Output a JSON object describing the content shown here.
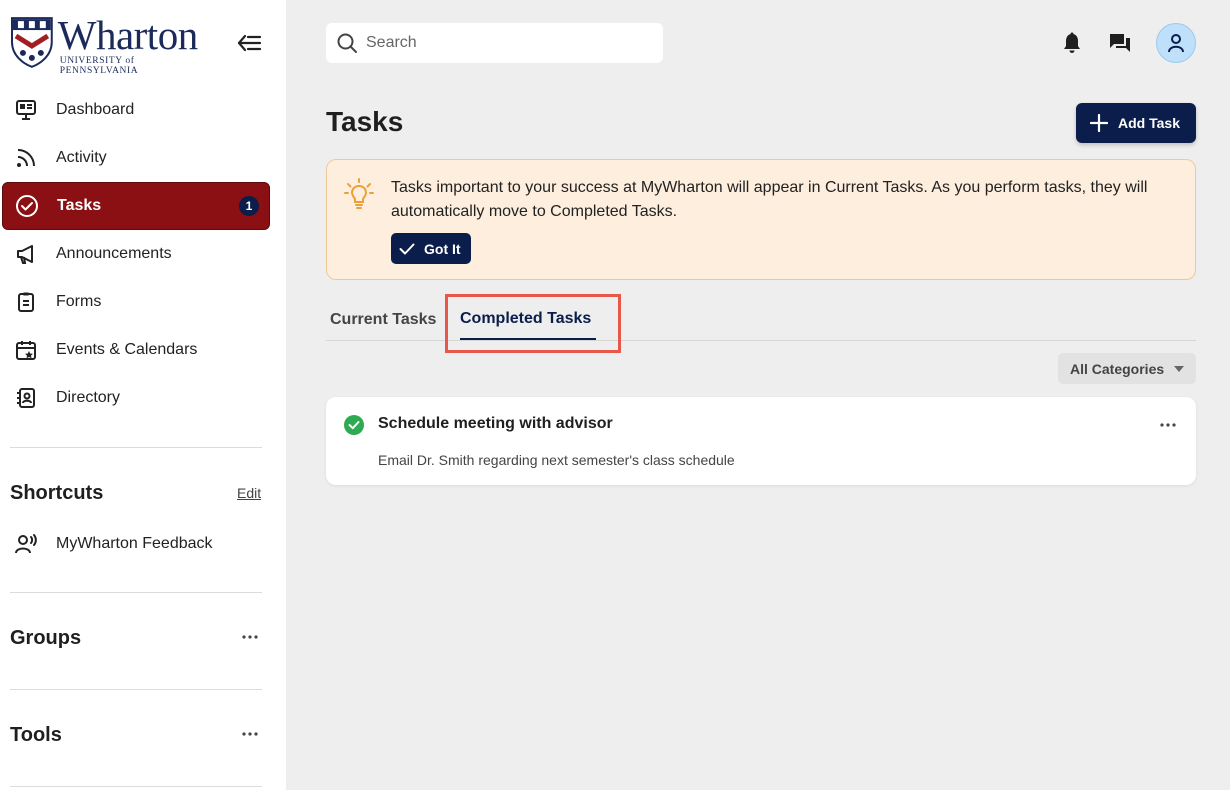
{
  "brand": {
    "name": "Wharton",
    "subtitle": "UNIVERSITY of PENNSYLVANIA",
    "colors": {
      "primary_navy": "#0b1d4a",
      "active_red": "#8b1014",
      "success_green": "#2eaa52",
      "banner_bg": "#fdeedd"
    }
  },
  "sidebar": {
    "collapse_icon": "collapse-left-icon",
    "items": [
      {
        "label": "Dashboard",
        "icon": "dashboard-icon",
        "active": false
      },
      {
        "label": "Activity",
        "icon": "rss-icon",
        "active": false
      },
      {
        "label": "Tasks",
        "icon": "check-circle-icon",
        "active": true,
        "badge": "1"
      },
      {
        "label": "Announcements",
        "icon": "megaphone-icon",
        "active": false
      },
      {
        "label": "Forms",
        "icon": "clipboard-icon",
        "active": false
      },
      {
        "label": "Events & Calendars",
        "icon": "calendar-star-icon",
        "active": false
      },
      {
        "label": "Directory",
        "icon": "contact-book-icon",
        "active": false
      }
    ],
    "shortcuts": {
      "title": "Shortcuts",
      "edit_label": "Edit",
      "items": [
        {
          "label": "MyWharton Feedback",
          "icon": "user-voice-icon"
        }
      ]
    },
    "groups": {
      "title": "Groups"
    },
    "tools": {
      "title": "Tools"
    }
  },
  "header": {
    "search": {
      "placeholder": "Search",
      "value": ""
    },
    "icons": [
      "bell-icon",
      "chat-icon",
      "user-avatar-icon"
    ]
  },
  "main": {
    "title": "Tasks",
    "add_task_label": "Add Task",
    "banner": {
      "text": "Tasks important to your success at MyWharton will appear in Current Tasks. As you perform tasks, they will automatically move to Completed Tasks.",
      "button_label": "Got It"
    },
    "tabs": [
      {
        "label": "Current Tasks",
        "selected": false
      },
      {
        "label": "Completed Tasks",
        "selected": true
      }
    ],
    "filter": {
      "selected": "All Categories"
    },
    "tasks": [
      {
        "title": "Schedule meeting with advisor",
        "description": "Email Dr. Smith regarding next semester's class schedule",
        "status": "completed"
      }
    ]
  }
}
